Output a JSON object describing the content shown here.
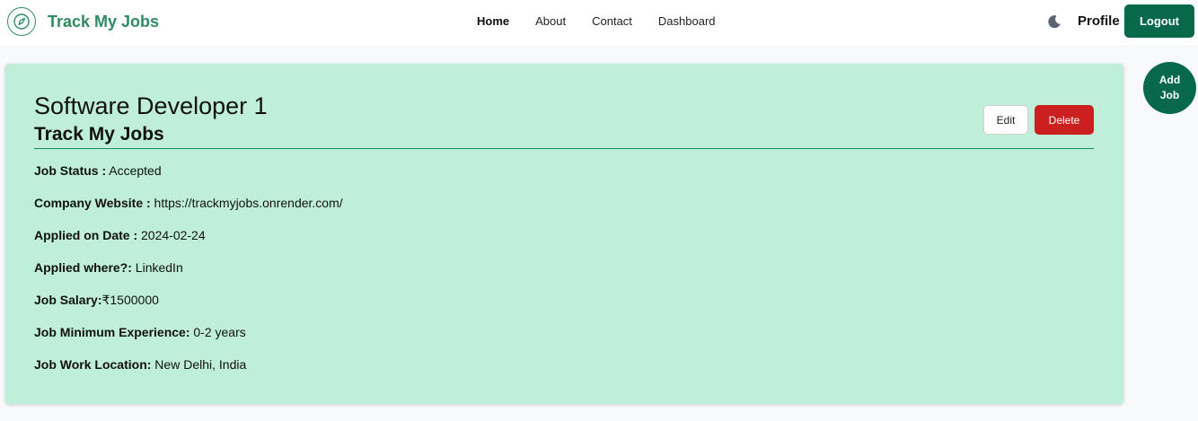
{
  "brand": {
    "name": "Track My Jobs",
    "logo_icon": "compass-icon",
    "color": "#2e8b62"
  },
  "nav": {
    "links": [
      "Home",
      "About",
      "Contact",
      "Dashboard"
    ],
    "active": "Home"
  },
  "header": {
    "theme_icon": "moon-icon",
    "profile_label": "Profile",
    "logout_label": "Logout"
  },
  "job": {
    "title": "Software Developer 1",
    "company": "Track My Jobs",
    "edit_label": "Edit",
    "delete_label": "Delete",
    "details": [
      {
        "label": "Job Status :",
        "value": " Accepted"
      },
      {
        "label": "Company Website :",
        "value": " https://trackmyjobs.onrender.com/"
      },
      {
        "label": "Applied on Date :",
        "value": " 2024-02-24"
      },
      {
        "label": "Applied where?:",
        "value": " LinkedIn"
      },
      {
        "label": "Job Salary:",
        "value": "₹1500000"
      },
      {
        "label": "Job Minimum Experience:",
        "value": " 0-2 years"
      },
      {
        "label": "Job Work Location:",
        "value": " New Delhi, India"
      }
    ]
  },
  "add_job_label": "Add Job",
  "colors": {
    "accent": "#07684a",
    "card_background": "#bfeedb",
    "delete": "#cc1f1f",
    "page_background": "#f8f9fb"
  }
}
